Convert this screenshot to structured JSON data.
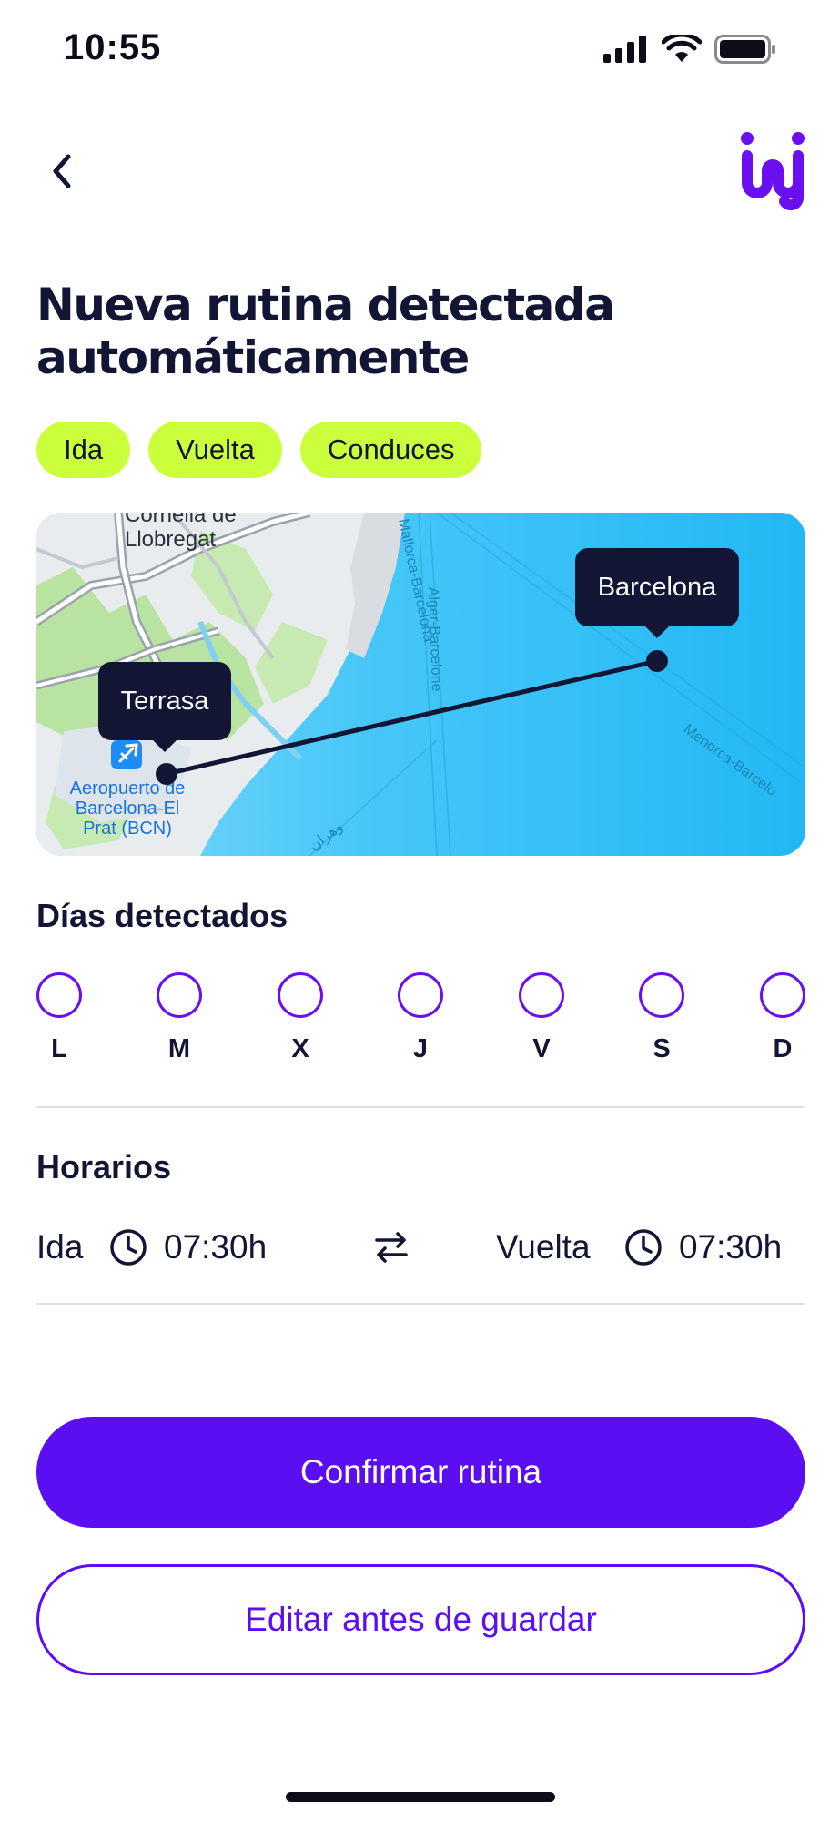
{
  "status_bar": {
    "time": "10:55"
  },
  "header": {
    "back_icon": "chevron-left-icon",
    "logo_icon": "brand-logo-icon"
  },
  "title": {
    "line1": "Nueva rutina detectada",
    "line2": "automáticamente"
  },
  "chips": [
    {
      "label": "Ida"
    },
    {
      "label": "Vuelta"
    },
    {
      "label": "Conduces"
    }
  ],
  "map": {
    "origin": {
      "label": "Terrasa"
    },
    "destination": {
      "label": "Barcelona"
    },
    "place_labels": {
      "cornella": "Cornellà de Llobregat",
      "cornella_line1": "Cornellà de",
      "cornella_line2": "Llobregat",
      "airport_line1": "Aeropuerto de",
      "airport_line2": "Barcelona-El",
      "airport_line3": "Prat (BCN)",
      "route1": "Mallorca-Barcelona",
      "route2": "Alger-Barcelone",
      "route3": "Menorca-Barcelo",
      "route4": "وهران"
    }
  },
  "days_section": {
    "heading": "Días detectados",
    "days": [
      {
        "letter": "L",
        "selected": false
      },
      {
        "letter": "M",
        "selected": false
      },
      {
        "letter": "X",
        "selected": false
      },
      {
        "letter": "J",
        "selected": false
      },
      {
        "letter": "V",
        "selected": false
      },
      {
        "letter": "S",
        "selected": false
      },
      {
        "letter": "D",
        "selected": false
      }
    ]
  },
  "schedule_section": {
    "heading": "Horarios",
    "outbound_label": "Ida",
    "outbound_time": "07:30h",
    "return_label": "Vuelta",
    "return_time": "07:30h",
    "swap_icon": "swap-arrows-icon",
    "clock_icon": "clock-icon"
  },
  "actions": {
    "confirm_label": "Confirmar rutina",
    "edit_label": "Editar antes de guardar"
  },
  "colors": {
    "primary": "#5b0ef2",
    "chip": "#cbff3c",
    "dark": "#121634",
    "sea": "#35c1f6"
  }
}
